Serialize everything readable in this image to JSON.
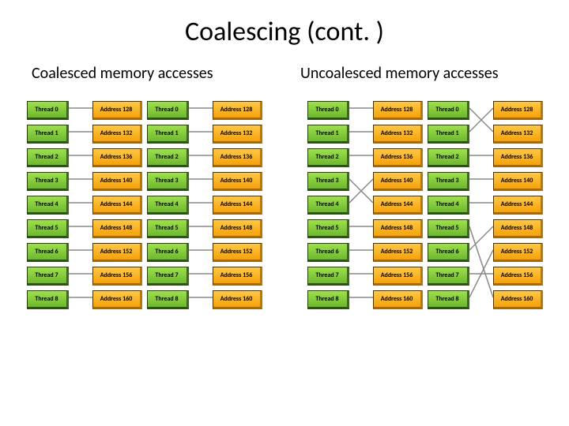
{
  "title": "Coalescing (cont. )",
  "subtitle_left": "Coalesced memory accesses",
  "subtitle_right": "Uncoalesced memory accesses",
  "threads": [
    {
      "label": "Thread 0"
    },
    {
      "label": "Thread 1"
    },
    {
      "label": "Thread 2"
    },
    {
      "label": "Thread 3"
    },
    {
      "label": "Thread 4"
    },
    {
      "label": "Thread 5"
    },
    {
      "label": "Thread 6"
    },
    {
      "label": "Thread 7"
    },
    {
      "label": "Thread 8"
    }
  ],
  "addresses": [
    {
      "label": "Address 128"
    },
    {
      "label": "Address 132"
    },
    {
      "label": "Address 136"
    },
    {
      "label": "Address 140"
    },
    {
      "label": "Address 144"
    },
    {
      "label": "Address 148"
    },
    {
      "label": "Address 152"
    },
    {
      "label": "Address 156"
    },
    {
      "label": "Address 160"
    }
  ],
  "mapping_coalesced_a": [
    0,
    1,
    2,
    3,
    4,
    5,
    6,
    7,
    8
  ],
  "mapping_coalesced_b": [
    0,
    1,
    2,
    3,
    4,
    5,
    6,
    7,
    8
  ],
  "mapping_uncoalesced_a": [
    0,
    1,
    2,
    4,
    3,
    5,
    6,
    7,
    8
  ],
  "mapping_uncoalesced_b": [
    1,
    0,
    2,
    3,
    4,
    8,
    5,
    7,
    6
  ]
}
